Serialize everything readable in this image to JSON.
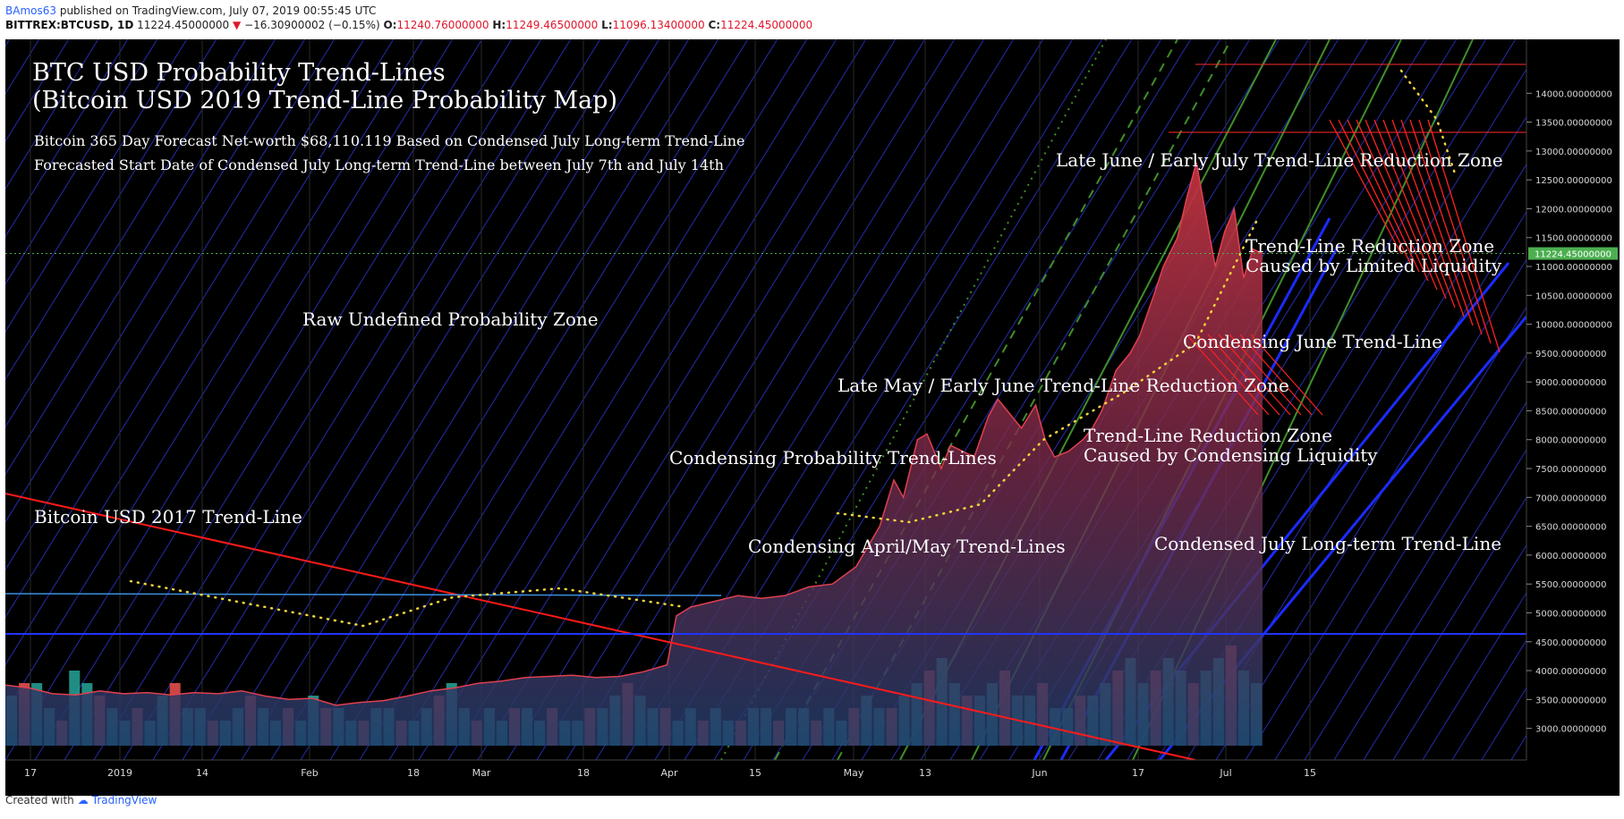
{
  "header": {
    "author": "BAmos63",
    "published": "published on TradingView.com, July 07, 2019 00:55:45 UTC",
    "symbol": "BITTREX:BTCUSD, 1D",
    "last": "11224.45000000",
    "change": "−16.30900002 (−0.15%)",
    "o_label": "O:",
    "o": "11240.76000000",
    "h_label": "H:",
    "h": "11249.46500000",
    "l_label": "L:",
    "l": "11096.13400000",
    "c_label": "C:",
    "c": "11224.45000000"
  },
  "footer": {
    "created_with": "Created with",
    "brand": "TradingView"
  },
  "colors": {
    "background": "#000000",
    "grid_diagonal": "#2a35c8",
    "price_area_top": "#c0323d",
    "price_area_bottom": "#1f3a68",
    "up_volume": "#26a69a",
    "down_volume": "#ef5350",
    "price_badge": "#4caf50"
  },
  "annotations": {
    "title_line1": "BTC USD Probability Trend-Lines",
    "title_line2": "(Bitcoin USD 2019 Trend-Line Probability Map)",
    "forecast": "Bitcoin 365 Day Forecast Net-worth $68,110.119 Based on Condensed July Long-term Trend-Line",
    "start_date": "Forecasted Start Date of Condensed July Long-term Trend-Line between July 7th and July 14th",
    "raw_zone": "Raw Undefined Probability Zone",
    "trend_2017": "Bitcoin USD 2017 Trend-Line",
    "condensing_prob": "Condensing Probability Trend-Lines",
    "april_may": "Condensing April/May Trend-Lines",
    "late_may": "Late May / Early June Trend-Line Reduction Zone",
    "cond_liq_1": "Trend-Line Reduction Zone",
    "cond_liq_2": "Caused by Condensing Liquidity",
    "june": "Condensing June Trend-Line",
    "lim_liq_1": "Trend-Line Reduction Zone",
    "lim_liq_2": "Caused by Limited Liquidity",
    "late_june": "Late June / Early July Trend-Line Reduction Zone",
    "condensed_july": "Condensed July Long-term Trend-Line"
  },
  "chart_data": {
    "type": "area",
    "y_ticks": [
      "14000.00000000",
      "13500.00000000",
      "13000.00000000",
      "12500.00000000",
      "12000.00000000",
      "11500.00000000",
      "11000.00000000",
      "10500.00000000",
      "10000.00000000",
      "9500.00000000",
      "9000.00000000",
      "8500.00000000",
      "8000.00000000",
      "7500.00000000",
      "7000.00000000",
      "6500.00000000",
      "6000.00000000",
      "5500.00000000",
      "5000.00000000",
      "4500.00000000",
      "4000.00000000",
      "3500.00000000",
      "3000.00000000"
    ],
    "x_ticks": [
      "17",
      "2019",
      "14",
      "Feb",
      "18",
      "Mar",
      "18",
      "Apr",
      "15",
      "May",
      "13",
      "Jun",
      "17",
      "Jul",
      "15"
    ],
    "last_price_label": "11224.45000000",
    "ylim": [
      2700,
      14500
    ],
    "price": [
      [
        0,
        3750
      ],
      [
        5,
        3700
      ],
      [
        10,
        3600
      ],
      [
        15,
        3580
      ],
      [
        20,
        3650
      ],
      [
        25,
        3600
      ],
      [
        30,
        3620
      ],
      [
        35,
        3580
      ],
      [
        40,
        3620
      ],
      [
        45,
        3600
      ],
      [
        50,
        3650
      ],
      [
        55,
        3560
      ],
      [
        60,
        3500
      ],
      [
        65,
        3520
      ],
      [
        70,
        3400
      ],
      [
        75,
        3450
      ],
      [
        80,
        3480
      ],
      [
        85,
        3560
      ],
      [
        90,
        3650
      ],
      [
        95,
        3700
      ],
      [
        100,
        3780
      ],
      [
        105,
        3820
      ],
      [
        110,
        3880
      ],
      [
        115,
        3900
      ],
      [
        120,
        3920
      ],
      [
        125,
        3880
      ],
      [
        130,
        3900
      ],
      [
        135,
        3980
      ],
      [
        140,
        4100
      ],
      [
        142,
        4950
      ],
      [
        145,
        5100
      ],
      [
        150,
        5200
      ],
      [
        155,
        5300
      ],
      [
        160,
        5250
      ],
      [
        165,
        5300
      ],
      [
        170,
        5450
      ],
      [
        175,
        5500
      ],
      [
        180,
        5800
      ],
      [
        185,
        6500
      ],
      [
        188,
        7300
      ],
      [
        190,
        7000
      ],
      [
        193,
        8000
      ],
      [
        195,
        8100
      ],
      [
        198,
        7500
      ],
      [
        200,
        7900
      ],
      [
        205,
        7700
      ],
      [
        208,
        8400
      ],
      [
        210,
        8700
      ],
      [
        212,
        8500
      ],
      [
        215,
        8200
      ],
      [
        218,
        8600
      ],
      [
        220,
        8000
      ],
      [
        222,
        7700
      ],
      [
        225,
        7800
      ],
      [
        228,
        8000
      ],
      [
        230,
        8200
      ],
      [
        232,
        8500
      ],
      [
        235,
        9200
      ],
      [
        238,
        9500
      ],
      [
        240,
        9800
      ],
      [
        243,
        10500
      ],
      [
        245,
        11000
      ],
      [
        248,
        11500
      ],
      [
        250,
        12200
      ],
      [
        252,
        12800
      ],
      [
        254,
        11900
      ],
      [
        256,
        11000
      ],
      [
        258,
        11600
      ],
      [
        260,
        12000
      ],
      [
        262,
        10800
      ],
      [
        264,
        11300
      ],
      [
        266,
        11224
      ]
    ],
    "volume": [
      4,
      5,
      5,
      3,
      2,
      6,
      5,
      4,
      3,
      2,
      3,
      2,
      4,
      5,
      3,
      3,
      2,
      2,
      3,
      4,
      3,
      2,
      3,
      2,
      4,
      3,
      3,
      2,
      2,
      3,
      3,
      2,
      2,
      3,
      4,
      5,
      3,
      2,
      3,
      2,
      3,
      3,
      2,
      3,
      2,
      2,
      3,
      3,
      4,
      5,
      4,
      3,
      3,
      2,
      3,
      2,
      3,
      2,
      2,
      3,
      3,
      2,
      3,
      3,
      2,
      3,
      2,
      3,
      4,
      3,
      3,
      4,
      5,
      6,
      7,
      5,
      4,
      4,
      5,
      6,
      4,
      4,
      5,
      3,
      3,
      4,
      4,
      5,
      6,
      7,
      5,
      6,
      7,
      6,
      5,
      6,
      7,
      8,
      6,
      5
    ],
    "series": [
      {
        "name": "BTCUSD",
        "values": "price"
      }
    ]
  }
}
